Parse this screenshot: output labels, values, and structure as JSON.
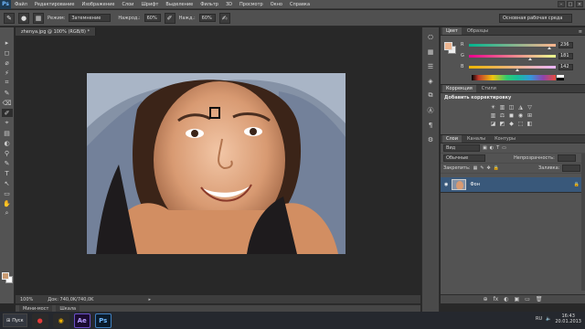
{
  "app": {
    "logo": "Ps"
  },
  "menu": [
    "Файл",
    "Редактирование",
    "Изображение",
    "Слои",
    "Шрифт",
    "Выделение",
    "Фильтр",
    "3D",
    "Просмотр",
    "Окно",
    "Справка"
  ],
  "window_controls": [
    "–",
    "□",
    "×"
  ],
  "options": {
    "mode_label": "Режим:",
    "mode_value": "Затемнение",
    "pressure_label": "Нажрод.:",
    "pressure_value": "60%",
    "press_label": "Нажд.:",
    "press_value": "60%",
    "workspace": "Основная рабочая среда"
  },
  "tools": [
    "▸",
    "◻",
    "⌀",
    "⚡",
    "⌗",
    "✎",
    "⌫",
    "✐",
    "⌖",
    "▤",
    "◐",
    "⚲",
    "✎",
    "T",
    "↖",
    "▭",
    "✋",
    "⌕"
  ],
  "document": {
    "tab_title": "zhenya.jpg @ 100% (RGB/8) *",
    "zoom": "100%",
    "doc_info": "Док: 740,0K/740,0K",
    "arrow": "▸",
    "mini_bridge": "Мини-мост",
    "timeline": "Шкала"
  },
  "midcol_icons": [
    "⎔",
    "▦",
    "☰",
    "◈",
    "⧉",
    "Ⓐ",
    "¶",
    "⚙"
  ],
  "color_panel": {
    "tabs": [
      "Цвет",
      "Образцы"
    ],
    "menu_icon": "≡",
    "channels": [
      {
        "name": "R",
        "value": "236",
        "pos": 0.93
      },
      {
        "name": "G",
        "value": "181",
        "pos": 0.71
      },
      {
        "name": "B",
        "value": "142",
        "pos": 0.56
      }
    ],
    "fg_color": "#ecb58e"
  },
  "corrections": {
    "tabs": [
      "Коррекция",
      "Стили"
    ],
    "title": "Добавить корректировку",
    "row1": [
      "☀",
      "▥",
      "◫",
      "◮",
      "▽"
    ],
    "row2": [
      "▥",
      "⚖",
      "◼",
      "◉",
      "⊞"
    ],
    "row3": [
      "◪",
      "◩",
      "◆",
      "⬚",
      "◧"
    ]
  },
  "layers": {
    "tabs": [
      "Слои",
      "Каналы",
      "Контуры"
    ],
    "kind_label": "Вид",
    "blend": "Обычные",
    "opacity_label": "Непрозрачность:",
    "lock_label": "Закрепить:",
    "fill_label": "Заливка:",
    "layer_name": "Фон",
    "footer_icons": [
      "⊕",
      "fx",
      "◐",
      "▣",
      "▭",
      "🗑"
    ]
  },
  "taskbar": {
    "start": "Пуск",
    "apps": [
      "●",
      "◉",
      "Ae",
      "Ps"
    ],
    "lang": "RU",
    "time": "16:43",
    "date": "20.01.2013"
  }
}
